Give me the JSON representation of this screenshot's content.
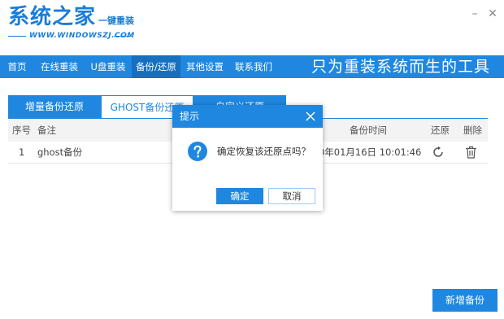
{
  "app": {
    "logo_text": "系统之家",
    "logo_sub": "一键重装",
    "logo_url": "WWW.WINDOWSZJ.COM"
  },
  "window": {
    "minimize": "–",
    "close": "✕"
  },
  "nav": {
    "items": [
      "首页",
      "在线重装",
      "U盘重装",
      "备份/还原",
      "其他设置",
      "联系我们"
    ],
    "active_index": 3,
    "slogan": "只为重装系统而生的工具"
  },
  "tabs": [
    "增量备份还原",
    "GHOST备份还原",
    "自定义还原"
  ],
  "active_tab_index": 1,
  "table": {
    "columns": [
      "序号",
      "备注",
      "备份时间",
      "还原",
      "删除"
    ],
    "rows": [
      {
        "index": "1",
        "note": "ghost备份",
        "time": "2020年01月16日 10:01:46"
      }
    ]
  },
  "dialog": {
    "title": "提示",
    "message": "确定恢复该还原点吗？",
    "ok_label": "确定",
    "cancel_label": "取消"
  },
  "add_button_label": "新增备份",
  "colors": {
    "accent": "#1f87e0",
    "accent_dark": "#166fbf",
    "header_bg": "#f3f3f3"
  },
  "icons": {
    "restore": "refresh-icon",
    "delete": "trash-icon",
    "dialog": "question-icon",
    "close": "close-icon"
  }
}
